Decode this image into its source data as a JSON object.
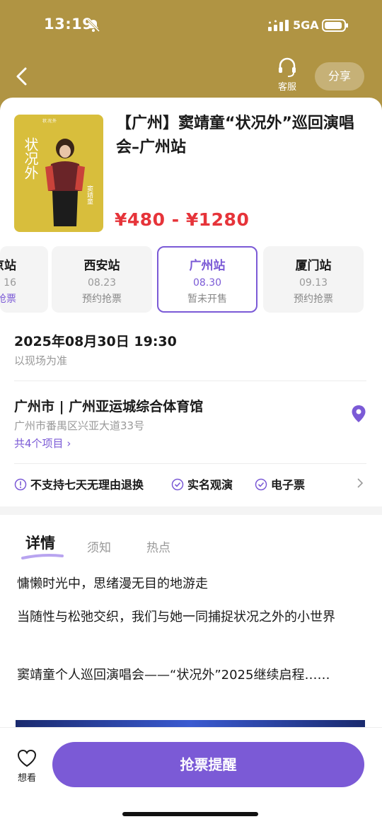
{
  "colors": {
    "header_gold": "#b09443",
    "accent_purple": "#7b5ad6",
    "price_red": "#e6343a"
  },
  "status_bar": {
    "time": "13:19",
    "network": "5GA",
    "icons": [
      "bell-slash-icon",
      "signal-icon",
      "battery-icon"
    ]
  },
  "nav": {
    "back_icon": "chevron-left-icon",
    "service_label": "客服",
    "service_icon": "headset-icon",
    "share_label": "分享"
  },
  "event": {
    "title": "【广州】窦靖童“状况外”巡回演唱会–广州站",
    "price": "¥480 - ¥1280",
    "poster": {
      "top_text": "状况外",
      "vertical_title": "状况外",
      "side_text": "窦靖童"
    }
  },
  "stations": [
    {
      "name": "京站",
      "date": "16",
      "status": "抢票"
    },
    {
      "name": "西安站",
      "date": "08.23",
      "status": "预约抢票"
    },
    {
      "name": "广州站",
      "date": "08.30",
      "status": "暂未开售"
    },
    {
      "name": "厦门站",
      "date": "09.13",
      "status": "预约抢票"
    }
  ],
  "schedule": {
    "datetime": "2025年08月30日 19:30",
    "note": "以现场为准"
  },
  "venue": {
    "name": "广州市 | 广州亚运城综合体育馆",
    "address": "广州市番禺区兴亚大道33号",
    "projects_link": "共4个项目",
    "icon": "location-pin-icon"
  },
  "policies": [
    {
      "icon": "info-circle-icon",
      "label": "不支持七天无理由退换"
    },
    {
      "icon": "check-circle-icon",
      "label": "实名观演"
    },
    {
      "icon": "check-circle-icon",
      "label": "电子票"
    }
  ],
  "tabs": [
    {
      "label": "详情",
      "active": true
    },
    {
      "label": "须知",
      "active": false
    },
    {
      "label": "热点",
      "active": false
    }
  ],
  "description": [
    "慵懒时光中，思绪漫无目的地游走",
    "当随性与松弛交织，我们与她一同捕捉状况之外的小世界",
    "窦靖童个人巡回演唱会——“状况外”2025继续启程……"
  ],
  "bottom": {
    "wish_label": "想看",
    "wish_icon": "heart-outline-icon",
    "cta_label": "抢票提醒"
  }
}
